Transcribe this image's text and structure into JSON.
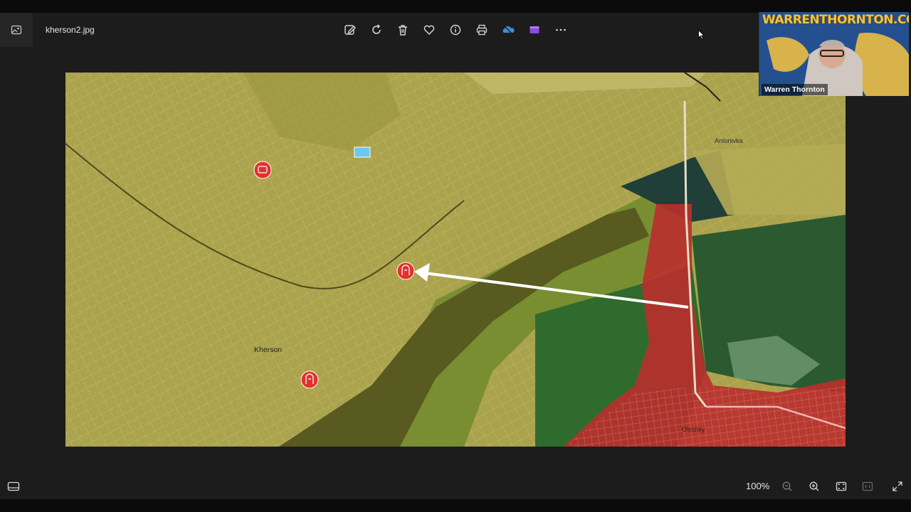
{
  "window": {
    "file_name": "kherson2.jpg"
  },
  "toolbar": {
    "items": [
      {
        "icon": "edit-icon"
      },
      {
        "icon": "rotate-icon"
      },
      {
        "icon": "delete-icon"
      },
      {
        "icon": "favorite-icon"
      },
      {
        "icon": "info-icon"
      },
      {
        "icon": "print-icon"
      },
      {
        "icon": "onedrive-icon"
      },
      {
        "icon": "clipchamp-icon"
      },
      {
        "icon": "more-icon"
      }
    ]
  },
  "map": {
    "labels": {
      "kherson": "Kherson",
      "antonivka": "Antonivka",
      "oleshky": "Oleshky"
    }
  },
  "webcam": {
    "site": "WARRENTHORNTON.COM",
    "name": "Warren Thornton"
  },
  "status": {
    "zoom": "100%"
  },
  "colors": {
    "accent": "#e2322e",
    "arrow": "#ffffff",
    "occupied": "#c0302e",
    "contested": "#2f6b2c"
  }
}
